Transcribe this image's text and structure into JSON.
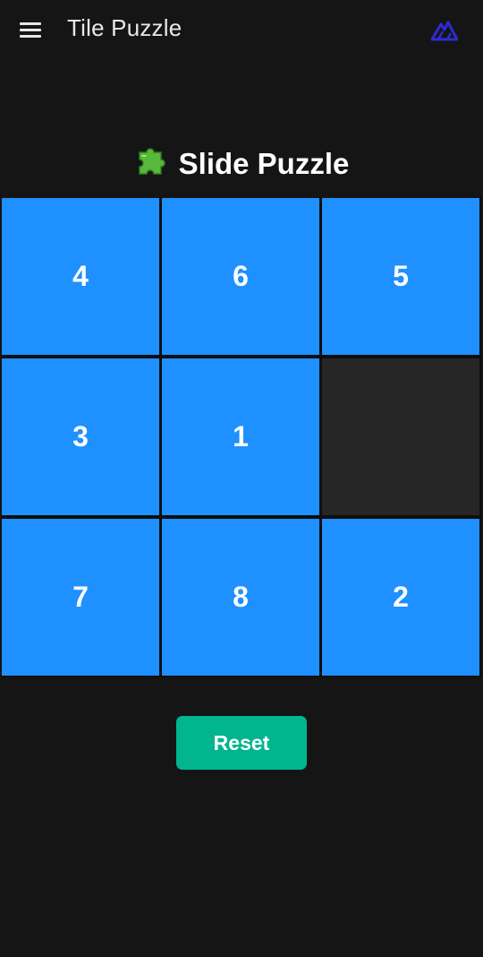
{
  "appbar": {
    "title": "Tile Puzzle",
    "menu_icon": "hamburger-menu-icon",
    "logo_icon": "mountain-logo-icon",
    "logo_color": "#2d2bd6"
  },
  "heading": {
    "icon": "puzzle-piece-icon",
    "text": "Slide Puzzle"
  },
  "board": {
    "rows": 3,
    "cols": 3,
    "tiles": [
      "4",
      "6",
      "5",
      "3",
      "1",
      "",
      "7",
      "8",
      "2"
    ],
    "tile_color": "#1e90ff",
    "empty_color": "#262626"
  },
  "reset": {
    "label": "Reset",
    "color": "#00b58f"
  }
}
